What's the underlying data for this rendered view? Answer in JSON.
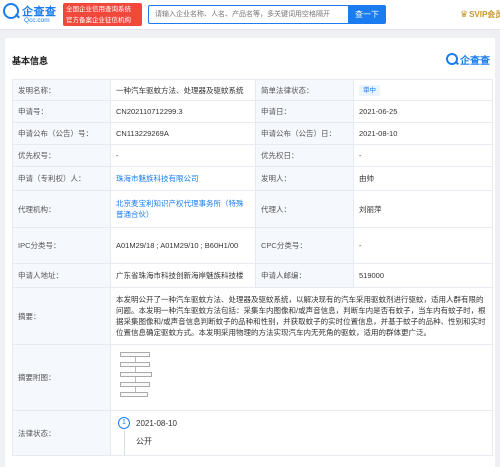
{
  "header": {
    "logo_cn": "企查查",
    "logo_en": "Qcc.com",
    "official_line1": "全国企业信用查询系统",
    "official_line2": "官方备案企业征信机构",
    "search_placeholder": "请输入企业名称、人名、产品名等，多关键词用空格隔开",
    "search_button": "查一下",
    "svip_label": "SVIP会员",
    "brand_color": "#1a7cf0"
  },
  "card": {
    "title": "基本信息",
    "logo_text": "企查查"
  },
  "info": {
    "invention_name_label": "发明名称：",
    "invention_name": "一种汽车驱蚊方法、处理器及驱蚊系统",
    "legal_status_label": "简单法律状态：",
    "legal_status": "审中",
    "app_no_label": "申请号：",
    "app_no": "CN202110712299.3",
    "app_date_label": "申请日：",
    "app_date": "2021-06-25",
    "pub_no_label": "申请公布（公告）号：",
    "pub_no": "CN113229269A",
    "pub_date_label": "申请公布（公告）日：",
    "pub_date": "2021-08-10",
    "priority_no_label": "优先权号：",
    "priority_no": "-",
    "priority_date_label": "优先权日：",
    "priority_date": "-",
    "applicant_label": "申请（专利权）人：",
    "applicant": "珠海市魅族科技有限公司",
    "inventor_label": "发明人：",
    "inventor": "由帅",
    "agency_label": "代理机构：",
    "agency": "北京麦宝利知识产权代理事务所（特殊普通合伙）",
    "agent_label": "代理人：",
    "agent": "刘丽萍",
    "ipc_label": "IPC分类号：",
    "ipc": "A01M29/18 ; A01M29/10 ; B60H1/00",
    "cpc_label": "CPC分类号：",
    "cpc": "-",
    "address_label": "申请人地址：",
    "address": "广东省珠海市科技创新海岸魅族科技楼",
    "postcode_label": "申请人邮编：",
    "postcode": "519000",
    "abstract_label": "摘要：",
    "abstract": "本发明公开了一种汽车驱蚊方法、处理器及驱蚊系统，以解决现有的汽车采用驱蚊剂进行驱蚊，适用人群有限的问题。本发明一种汽车驱蚊方法包括：采集车内图像和/或声音信息，判断车内是否有蚊子，当车内有蚊子时，根据采集图像和/或声音信息判断蚊子的品种和性别，并获取蚊子的实时位置信息，并基于蚊子的品种、性别和实时位置信息确定驱蚊方式。本发明采用物理的方法实现汽车内无死角的驱蚊，适用的群体更广泛。",
    "abstract_image_label": "摘要附图：",
    "law_status_label": "法律状态：",
    "timeline_index": "1",
    "timeline_date": "2021-08-10",
    "timeline_status": "公开"
  }
}
